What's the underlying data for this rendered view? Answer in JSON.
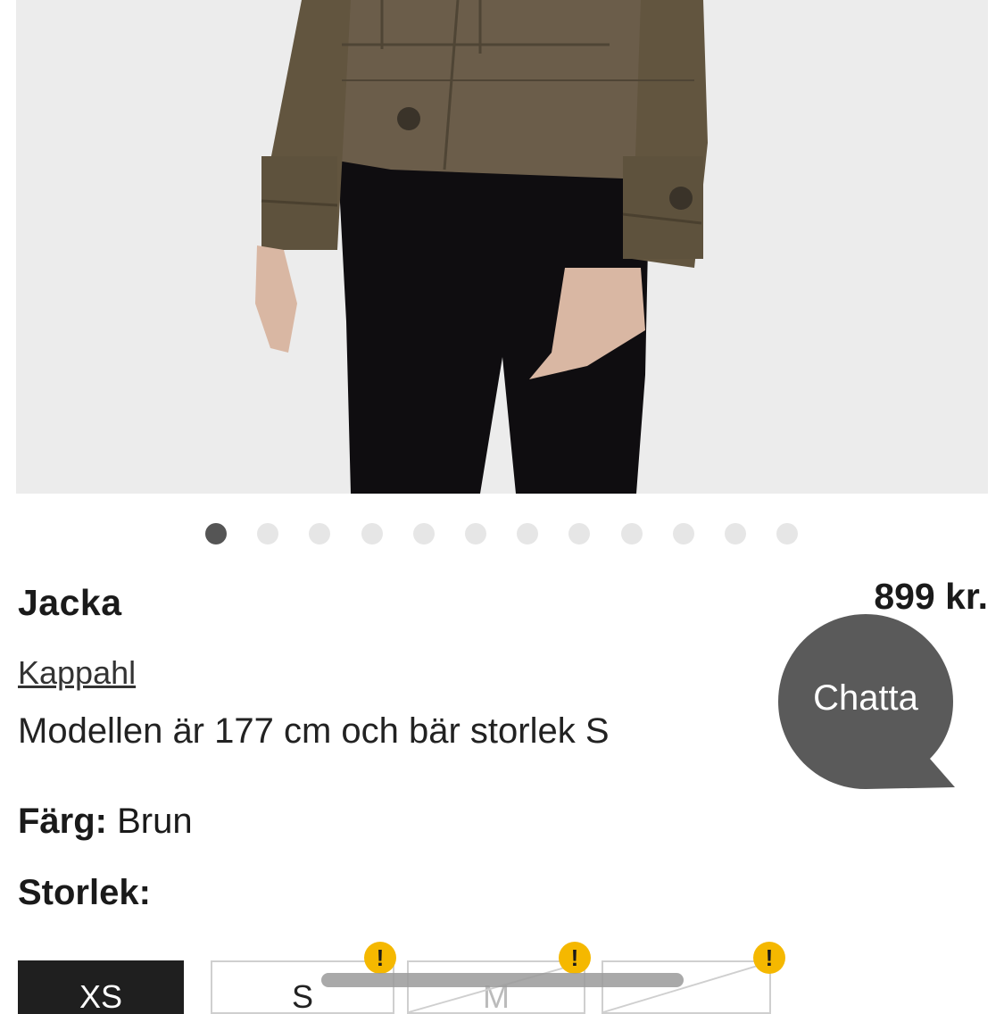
{
  "product": {
    "title": "Jacka",
    "price": "899 kr.",
    "brand": "Kappahl",
    "model_note": "Modellen är 177 cm och bär storlek S",
    "color_label": "Färg:",
    "color_value": "Brun",
    "size_label": "Storlek:"
  },
  "gallery": {
    "total_images": 12,
    "active_index": 0
  },
  "chat": {
    "label": "Chatta",
    "color": "#5a5a5a"
  },
  "sizes": [
    {
      "label": "XS",
      "selected": true
    },
    {
      "label": "S",
      "selected": false,
      "warning": "!"
    },
    {
      "label": "M",
      "selected": false,
      "warning": "!"
    },
    {
      "label": "",
      "selected": false,
      "warning": "!"
    }
  ],
  "colors": {
    "jacket": "#6b5d4a",
    "pants": "#0f0d10",
    "background": "#ececec",
    "warning": "#f5b800"
  }
}
